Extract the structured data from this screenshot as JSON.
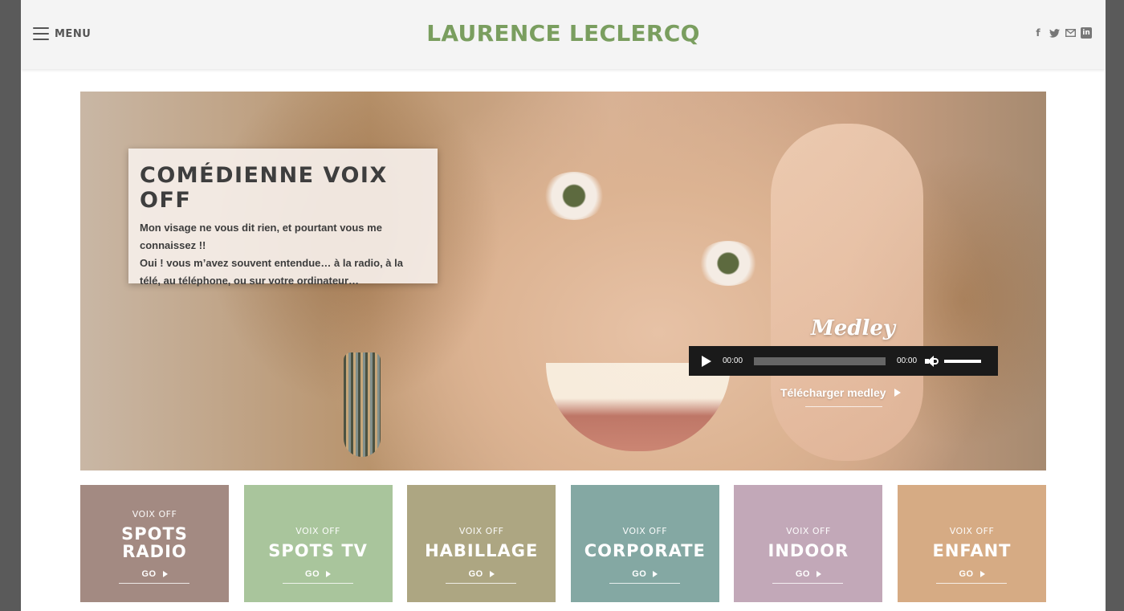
{
  "header": {
    "menu_label": "MENU",
    "site_title": "LAURENCE LECLERCQ",
    "social": [
      {
        "icon": "facebook-icon",
        "glyph": "f"
      },
      {
        "icon": "twitter-icon",
        "glyph": "🐦"
      },
      {
        "icon": "email-icon",
        "glyph": "✉"
      },
      {
        "icon": "linkedin-icon",
        "glyph": "in"
      }
    ]
  },
  "hero": {
    "title": "COMÉDIENNE VOIX OFF",
    "text_line1": "Mon visage ne vous dit rien, et pourtant vous me connaissez !!",
    "text_line2": "Oui ! vous m’avez souvent entendue… à la radio, à la télé, au téléphone, ou sur votre ordinateur…",
    "medley_title": "Medley",
    "player": {
      "current_time": "00:00",
      "duration": "00:00",
      "progress": 0,
      "volume": 1
    },
    "download_label": "Télécharger medley"
  },
  "tiles": [
    {
      "small": "VOIX OFF",
      "big": "SPOTS\nRADIO",
      "go": "GO",
      "color": "#a38a82"
    },
    {
      "small": "VOIX OFF",
      "big": "SPOTS TV",
      "go": "GO",
      "color": "#a9c59c"
    },
    {
      "small": "VOIX OFF",
      "big": "HABILLAGE",
      "go": "GO",
      "color": "#ada682"
    },
    {
      "small": "VOIX OFF",
      "big": "CORPORATE",
      "go": "GO",
      "color": "#84a8a3"
    },
    {
      "small": "VOIX OFF",
      "big": "INDOOR",
      "go": "GO",
      "color": "#c2a8b8"
    },
    {
      "small": "VOIX OFF",
      "big": "ENFANT",
      "go": "GO",
      "color": "#d6ab84"
    }
  ],
  "colors": {
    "title_green": "#7a9e5f",
    "player_bg": "#1a1a1a",
    "page_bg": "#5a5a5a"
  }
}
